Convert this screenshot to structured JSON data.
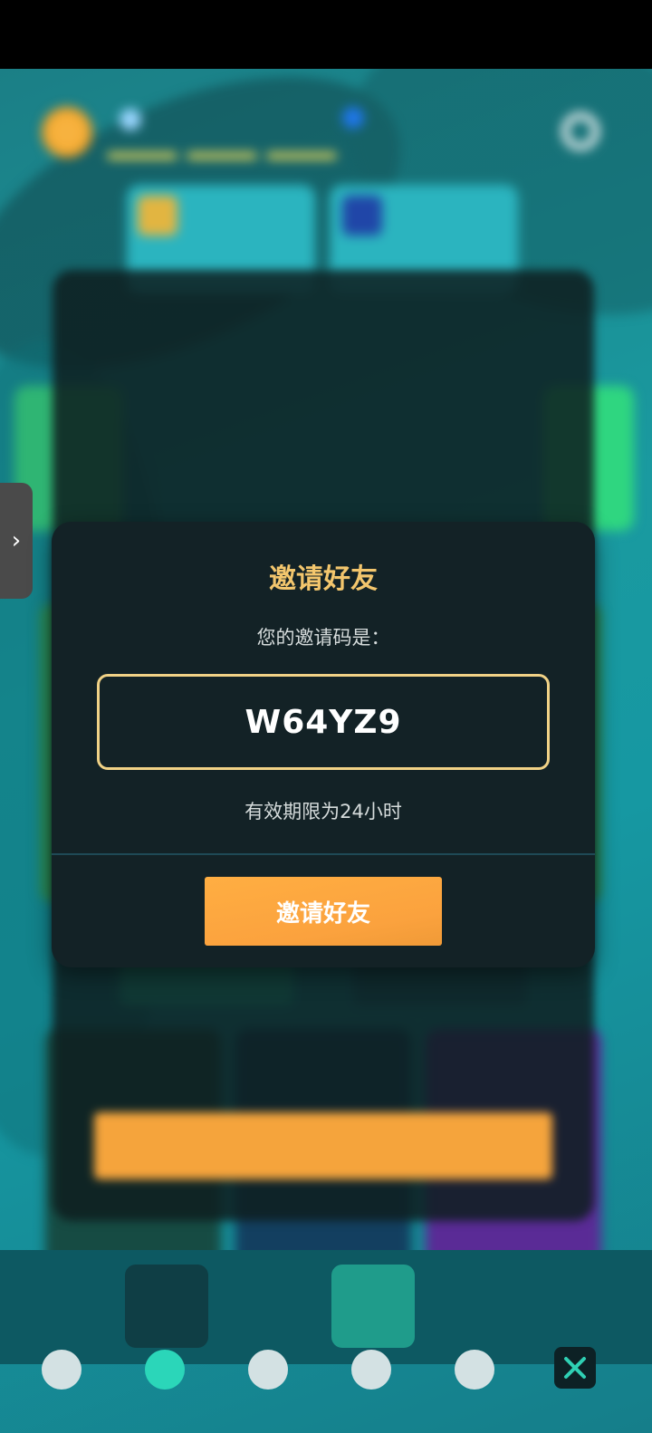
{
  "dialog": {
    "title": "邀请好友",
    "subtitle": "您的邀请码是：",
    "code": "W64YZ9",
    "validity": "有效期限为24小时",
    "button_label": "邀请好友"
  },
  "side_tab": {
    "icon": "chevron-right-icon"
  },
  "close_button": {
    "icon": "close-icon",
    "color": "#2fd0b4"
  },
  "colors": {
    "accent_gold": "#f3c66d",
    "button_orange": "#fba23e",
    "dialog_bg": "#132226"
  }
}
